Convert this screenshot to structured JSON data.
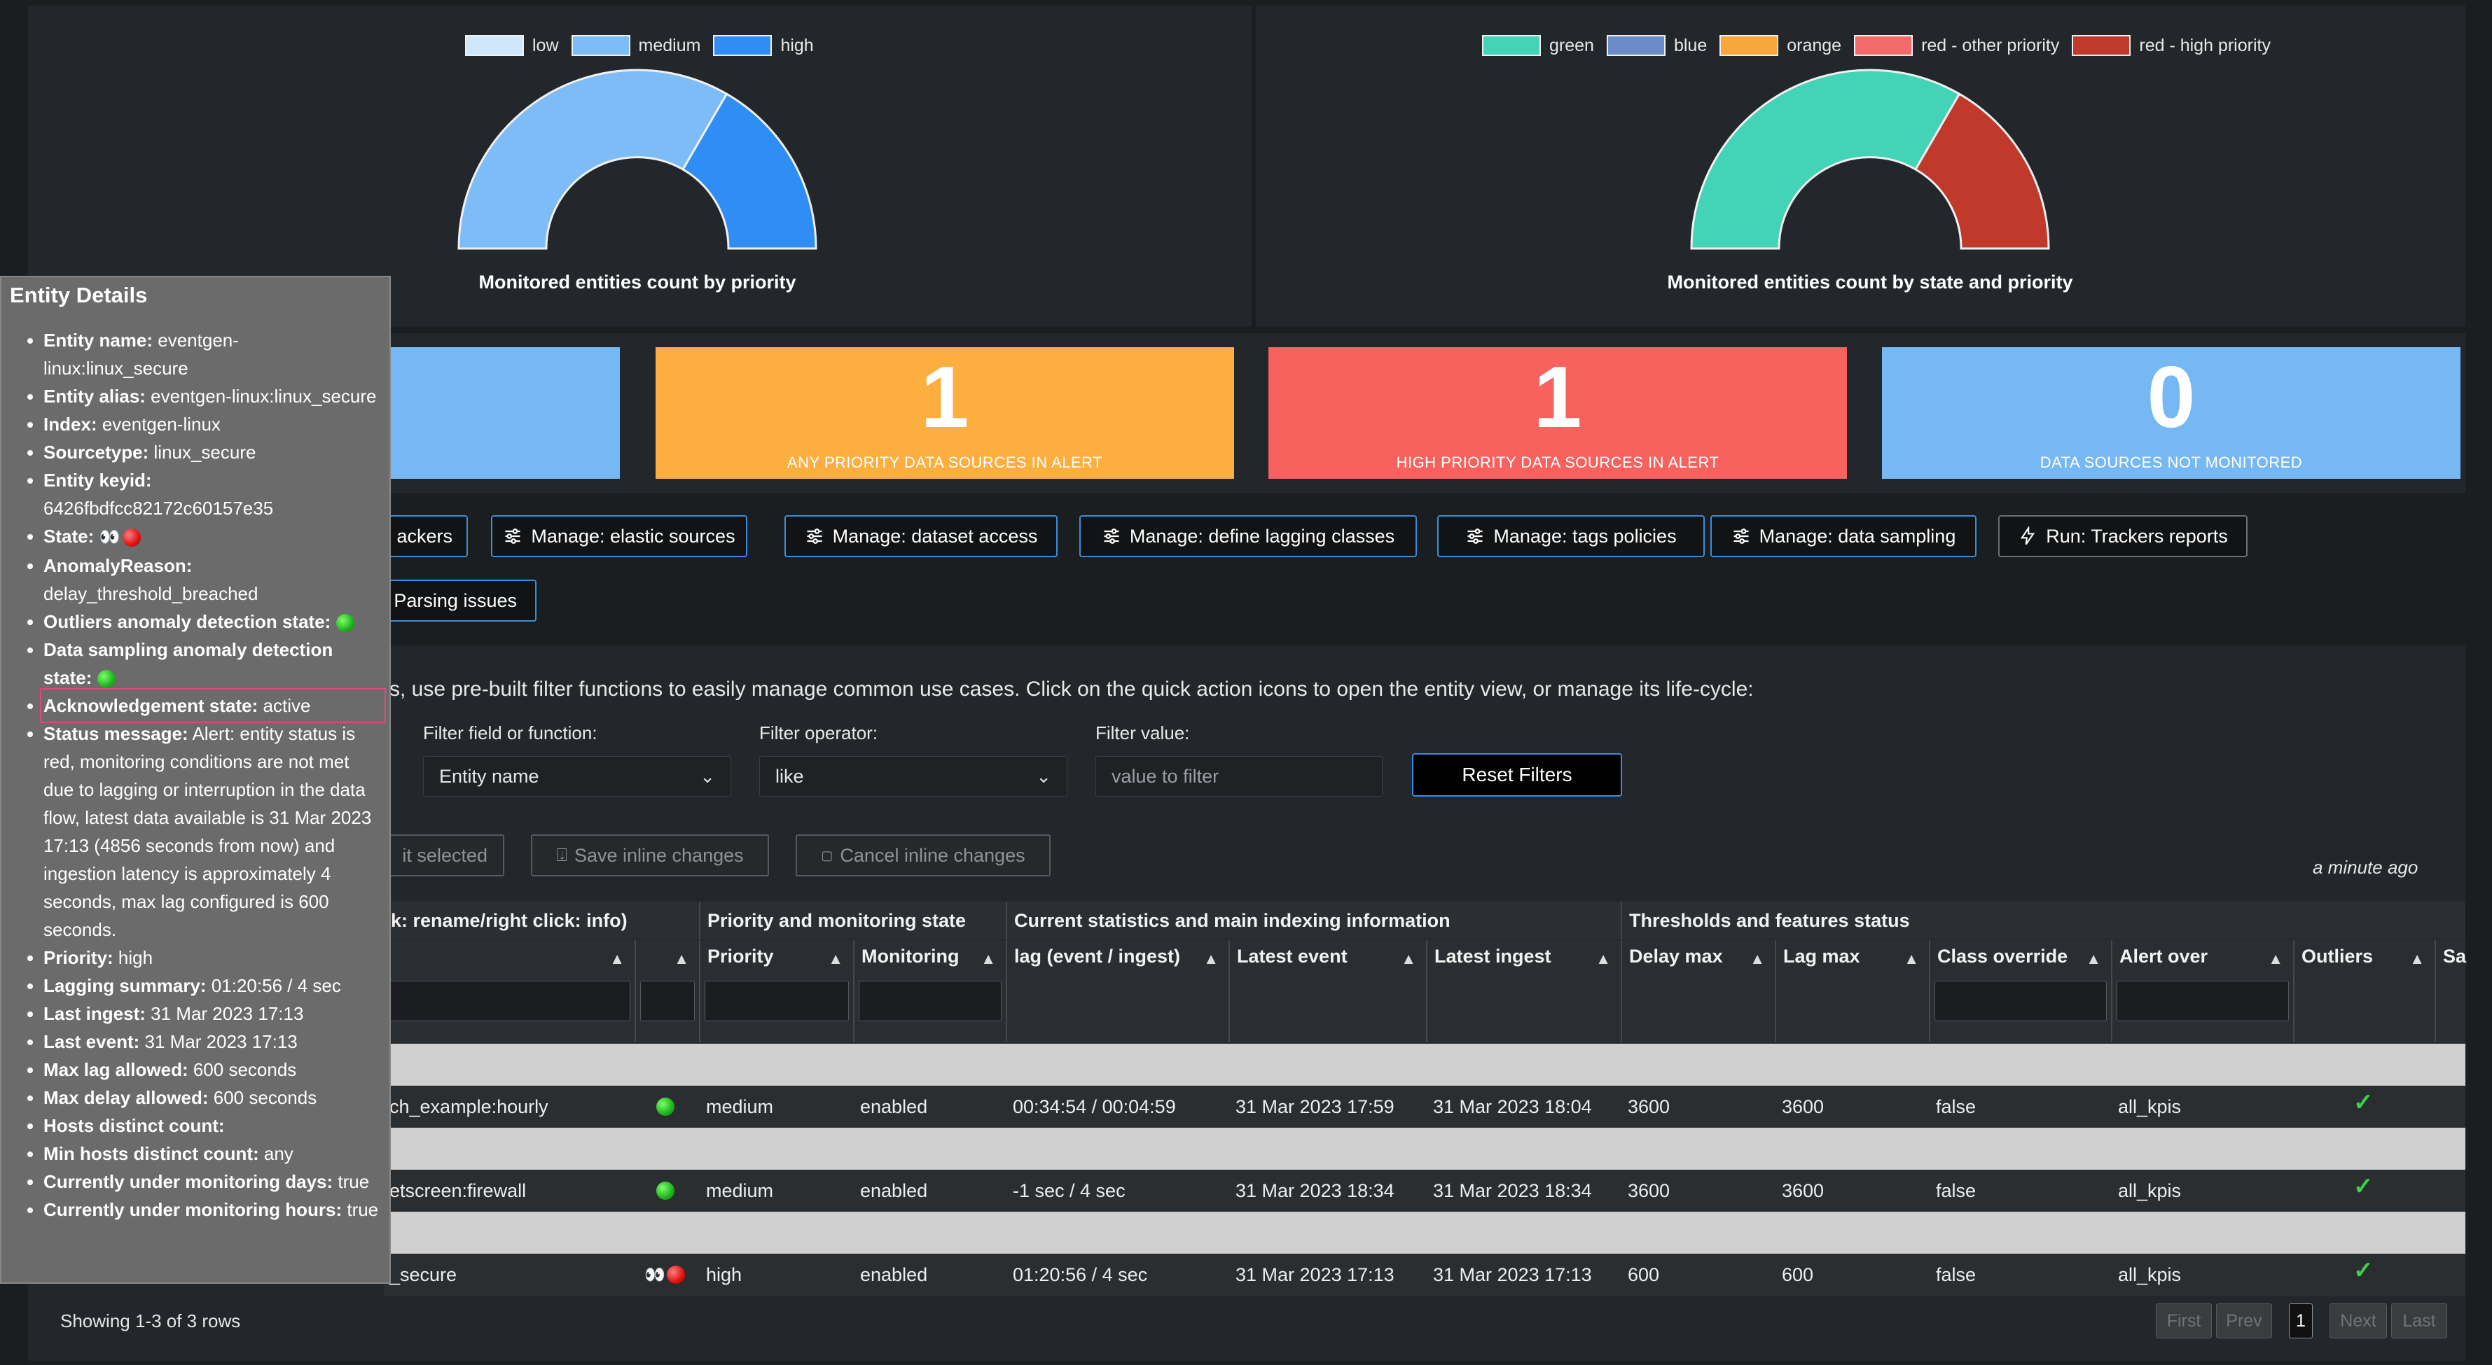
{
  "charts": {
    "priority": {
      "title": "Monitored entities count by priority",
      "legend": [
        {
          "label": "low",
          "color": "#cfe6fb"
        },
        {
          "label": "medium",
          "color": "#7ebcf7"
        },
        {
          "label": "high",
          "color": "#2f8ef5"
        }
      ]
    },
    "state": {
      "title": "Monitored entities count by state and priority",
      "legend": [
        {
          "label": "green",
          "color": "#43d3b6"
        },
        {
          "label": "blue",
          "color": "#6b8cc9"
        },
        {
          "label": "orange",
          "color": "#f7a73b"
        },
        {
          "label": "red - other priority",
          "color": "#f26a6a"
        },
        {
          "label": "red - high priority",
          "color": "#c0392b"
        }
      ]
    }
  },
  "chart_data": [
    {
      "type": "pie",
      "title": "Monitored entities count by priority",
      "categories": [
        "low",
        "medium",
        "high"
      ],
      "values": [
        0,
        2,
        1
      ]
    },
    {
      "type": "pie",
      "title": "Monitored entities count by state and priority",
      "categories": [
        "green",
        "blue",
        "orange",
        "red - other priority",
        "red - high priority"
      ],
      "values": [
        2,
        0,
        0,
        0,
        1
      ]
    }
  ],
  "kpis": [
    {
      "value": "1",
      "label": "ANY PRIORITY DATA SOURCES IN ALERT",
      "color": "#fcae3f"
    },
    {
      "value": "1",
      "label": "HIGH PRIORITY DATA SOURCES IN ALERT",
      "color": "#f7625f"
    },
    {
      "value": "0",
      "label": "DATA SOURCES NOT MONITORED",
      "color": "#75b8f4"
    }
  ],
  "buttons": {
    "trackers_partial": "ackers",
    "elastic": "Manage: elastic sources",
    "dataset": "Manage: dataset access",
    "lagging": "Manage: define lagging classes",
    "tags": "Manage: tags policies",
    "sampling": "Manage: data sampling",
    "reports": "Run: Trackers reports",
    "parsing": "Parsing issues"
  },
  "info_text": "s, use pre-built filter functions to easily manage common use cases. Click on the quick action icons to open the entity view, or manage its life-cycle:",
  "filters": {
    "field_label": "Filter field or function:",
    "field_value": "Entity name",
    "operator_label": "Filter operator:",
    "operator_value": "like",
    "value_label": "Filter value:",
    "value_placeholder": "value to filter",
    "reset": "Reset Filters"
  },
  "actions": {
    "edit_selected_partial": "it selected",
    "save": "Save inline changes",
    "cancel": "Cancel inline changes",
    "updated": "a minute ago"
  },
  "table": {
    "groups": {
      "g1": "k: rename/right click: info)",
      "g2": "Priority and monitoring state",
      "g3": "Current statistics and main indexing information",
      "g4": "Thresholds and features status"
    },
    "headers": {
      "priority": "Priority",
      "monitoring": "Monitoring",
      "lag": "lag (event / ingest)",
      "latest_event": "Latest event",
      "latest_ingest": "Latest ingest",
      "delay_max": "Delay max",
      "lag_max": "Lag max",
      "class_override": "Class override",
      "alert_over": "Alert over",
      "outliers": "Outliers",
      "sa": "Sa"
    },
    "rows": [
      {
        "name": "ch_example:hourly",
        "state": "green",
        "priority": "medium",
        "monitoring": "enabled",
        "lag": "00:34:54 / 00:04:59",
        "latest_event": "31 Mar 2023 17:59",
        "latest_ingest": "31 Mar 2023 18:04",
        "delay_max": "3600",
        "lag_max": "3600",
        "class_override": "false",
        "alert_over": "all_kpis"
      },
      {
        "name": "etscreen:firewall",
        "state": "green",
        "priority": "medium",
        "monitoring": "enabled",
        "lag": "-1 sec / 4 sec",
        "latest_event": "31 Mar 2023 18:34",
        "latest_ingest": "31 Mar 2023 18:34",
        "delay_max": "3600",
        "lag_max": "3600",
        "class_override": "false",
        "alert_over": "all_kpis"
      },
      {
        "name": "_secure",
        "state": "red",
        "priority": "high",
        "monitoring": "enabled",
        "lag": "01:20:56 / 4 sec",
        "latest_event": "31 Mar 2023 17:13",
        "latest_ingest": "31 Mar 2023 17:13",
        "delay_max": "600",
        "lag_max": "600",
        "class_override": "false",
        "alert_over": "all_kpis"
      }
    ],
    "footer": "Showing 1-3 of 3 rows",
    "pager": {
      "first": "First",
      "prev": "Prev",
      "current": "1",
      "next": "Next",
      "last": "Last"
    }
  },
  "popup": {
    "title": "Entity Details",
    "items": [
      {
        "k": "Entity name:",
        "v": "eventgen-linux:linux_secure"
      },
      {
        "k": "Entity alias:",
        "v": "eventgen-linux:linux_secure"
      },
      {
        "k": "Index:",
        "v": "eventgen-linux"
      },
      {
        "k": "Sourcetype:",
        "v": "linux_secure"
      },
      {
        "k": "Entity keyid:",
        "v": "6426fbdfcc82172c60157e35"
      },
      {
        "k": "State:",
        "v": ""
      },
      {
        "k": "AnomalyReason:",
        "v": "delay_threshold_breached"
      },
      {
        "k": "Outliers anomaly detection state:",
        "v": ""
      },
      {
        "k": "Data sampling anomaly detection state:",
        "v": ""
      },
      {
        "k": "Acknowledgement state:",
        "v": "active"
      },
      {
        "k": "Status message:",
        "v": "Alert: entity status is red, monitoring conditions are not met due to lagging or interruption in the data flow, latest data available is 31 Mar 2023 17:13 (4856 seconds from now) and ingestion latency is approximately 4 seconds, max lag configured is 600 seconds."
      },
      {
        "k": "Priority:",
        "v": "high"
      },
      {
        "k": "Lagging summary:",
        "v": "01:20:56 / 4 sec"
      },
      {
        "k": "Last ingest:",
        "v": "31 Mar 2023 17:13"
      },
      {
        "k": "Last event:",
        "v": "31 Mar 2023 17:13"
      },
      {
        "k": "Max lag allowed:",
        "v": "600 seconds"
      },
      {
        "k": "Max delay allowed:",
        "v": "600 seconds"
      },
      {
        "k": "Hosts distinct count:",
        "v": ""
      },
      {
        "k": "Min hosts distinct count:",
        "v": "any"
      },
      {
        "k": "Currently under monitoring days:",
        "v": "true"
      },
      {
        "k": "Currently under monitoring hours:",
        "v": "true"
      }
    ]
  }
}
